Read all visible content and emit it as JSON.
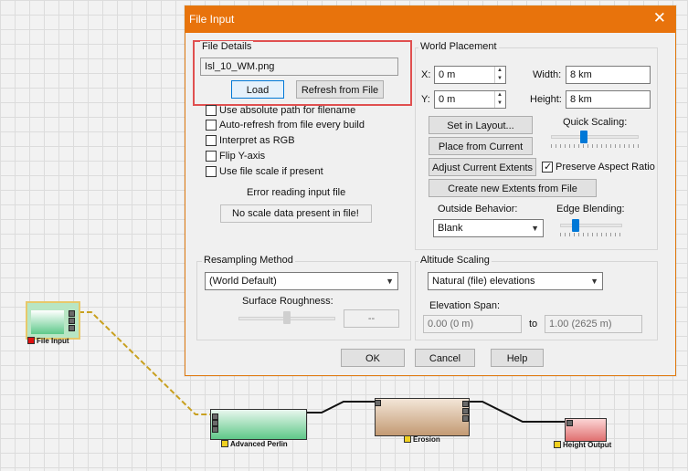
{
  "graph": {
    "nodes": {
      "file_input": "File Input",
      "advanced_perlin": "Advanced Perlin",
      "erosion": "Erosion",
      "height_output": "Height Output"
    }
  },
  "dialog": {
    "title": "File Input",
    "close_glyph": "✕",
    "file_details": {
      "label": "File Details",
      "filename": "Isl_10_WM.png",
      "load_label": "Load",
      "refresh_label": "Refresh from File"
    },
    "options": [
      {
        "label": "Use absolute path for filename",
        "checked": false
      },
      {
        "label": "Auto-refresh from file every build",
        "checked": false
      },
      {
        "label": "Interpret as RGB",
        "checked": false
      },
      {
        "label": "Flip Y-axis",
        "checked": false
      },
      {
        "label": "Use file scale if present",
        "checked": false
      }
    ],
    "error_text": "Error reading input file",
    "scale_status": "No scale data present in file!",
    "world_placement": {
      "label": "World Placement",
      "x_label": "X:",
      "x_value": "0 m",
      "y_label": "Y:",
      "y_value": "0 m",
      "width_label": "Width:",
      "width_value": "8 km",
      "height_label": "Height:",
      "height_value": "8 km",
      "set_in_layout": "Set in Layout...",
      "place_from_current": "Place from Current",
      "adjust_extents": "Adjust Current Extents",
      "new_extents": "Create new Extents from File",
      "quick_scaling_label": "Quick Scaling:",
      "preserve_aspect_label": "Preserve Aspect Ratio",
      "preserve_aspect_checked": true,
      "preserve_check_glyph": "✓",
      "outside_behavior_label": "Outside Behavior:",
      "outside_behavior_value": "Blank",
      "edge_blending_label": "Edge Blending:"
    },
    "resampling": {
      "label": "Resampling Method",
      "method_value": "(World Default)",
      "roughness_label": "Surface Roughness:",
      "roughness_value": "--"
    },
    "altitude": {
      "label": "Altitude Scaling",
      "mode_value": "Natural (file) elevations",
      "span_label": "Elevation Span:",
      "span_from": "0.00 (0 m)",
      "span_to_label": "to",
      "span_to": "1.00 (2625 m)"
    },
    "buttons": {
      "ok": "OK",
      "cancel": "Cancel",
      "help": "Help"
    }
  },
  "colors": {
    "titlebar": "#e8730c",
    "highlight_box": "#e05050",
    "accent": "#0078d7"
  }
}
